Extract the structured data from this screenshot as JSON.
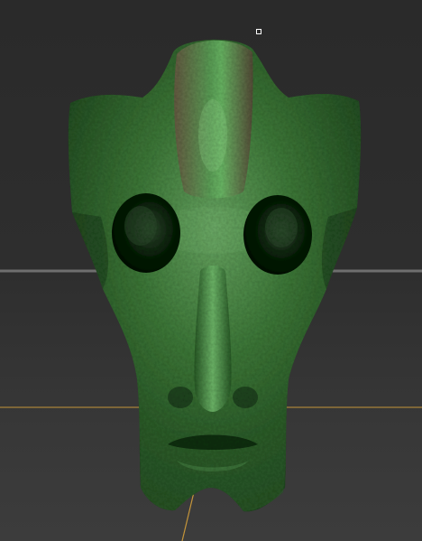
{
  "viewport": {
    "background_top": "#2a2a2a",
    "background_bottom": "#3c3c3c",
    "grid_line_color": "#6f6f6f",
    "axis_line_color": "#c4953a",
    "model": {
      "subject": "alien-head-sculpt",
      "base_color": "#3f7a3a",
      "highlight_color": "#7fc37a",
      "shadow_color": "#173017",
      "crest_color": "#5b5a3e"
    }
  }
}
